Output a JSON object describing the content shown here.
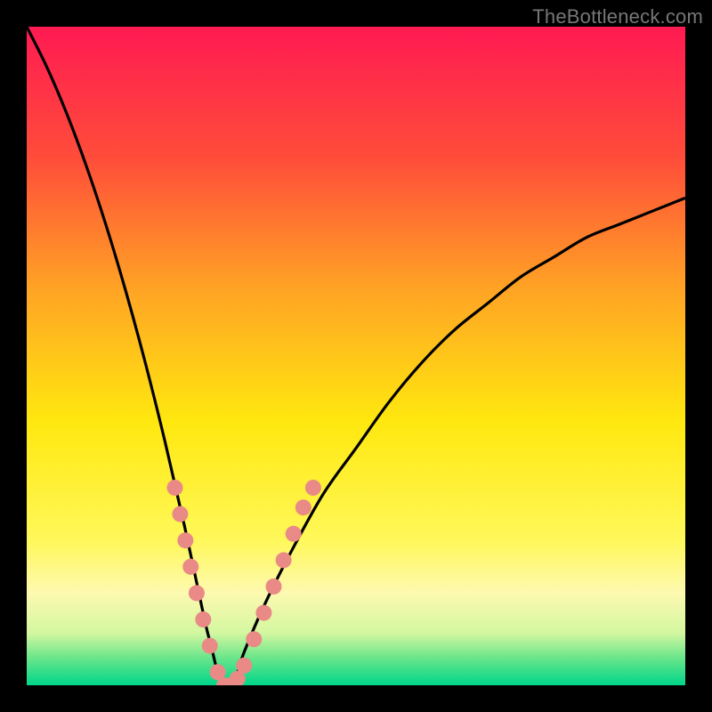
{
  "watermark": "TheBottleneck.com",
  "chart_data": {
    "type": "line",
    "title": "",
    "xlabel": "",
    "ylabel": "",
    "xlim": [
      0,
      100
    ],
    "ylim": [
      0,
      100
    ],
    "grid": false,
    "legend": false,
    "optimal_x": 30,
    "background_gradient": {
      "stops": [
        {
          "offset": 0,
          "color": "#ff1a52"
        },
        {
          "offset": 20,
          "color": "#ff4d3a"
        },
        {
          "offset": 40,
          "color": "#ffa424"
        },
        {
          "offset": 60,
          "color": "#ffe80f"
        },
        {
          "offset": 78,
          "color": "#fff85a"
        },
        {
          "offset": 86,
          "color": "#fdf9b0"
        },
        {
          "offset": 92,
          "color": "#d4f7a0"
        },
        {
          "offset": 96,
          "color": "#66e58a"
        },
        {
          "offset": 100,
          "color": "#00d58a"
        }
      ]
    },
    "series": [
      {
        "name": "bottleneck-curve",
        "description": "V-shaped bottleneck curve; minimum (0) at x≈30, rises steeply left toward 100 and gradually right toward ~70-75",
        "x": [
          0,
          3,
          6,
          9,
          12,
          15,
          18,
          21,
          24,
          27,
          28,
          29,
          30,
          31,
          32,
          33,
          36,
          40,
          45,
          50,
          55,
          60,
          65,
          70,
          75,
          80,
          85,
          90,
          95,
          100
        ],
        "y": [
          100,
          94,
          87,
          79,
          70,
          60,
          49,
          37,
          24,
          10,
          6,
          2,
          0,
          0,
          2,
          5,
          12,
          20,
          29,
          36,
          43,
          49,
          54,
          58,
          62,
          65,
          68,
          70,
          72,
          74
        ]
      }
    ],
    "markers": {
      "name": "curve-markers",
      "color": "#e98a86",
      "radius": 9,
      "points": [
        {
          "x": 22.5,
          "y": 30
        },
        {
          "x": 23.3,
          "y": 26
        },
        {
          "x": 24.1,
          "y": 22
        },
        {
          "x": 24.9,
          "y": 18
        },
        {
          "x": 25.8,
          "y": 14
        },
        {
          "x": 26.8,
          "y": 10
        },
        {
          "x": 27.8,
          "y": 6
        },
        {
          "x": 29.0,
          "y": 2
        },
        {
          "x": 30.0,
          "y": 0
        },
        {
          "x": 31.0,
          "y": 0
        },
        {
          "x": 32.0,
          "y": 1
        },
        {
          "x": 33.0,
          "y": 3
        },
        {
          "x": 34.5,
          "y": 7
        },
        {
          "x": 36.0,
          "y": 11
        },
        {
          "x": 37.5,
          "y": 15
        },
        {
          "x": 39.0,
          "y": 19
        },
        {
          "x": 40.5,
          "y": 23
        },
        {
          "x": 42.0,
          "y": 27
        },
        {
          "x": 43.5,
          "y": 30
        }
      ]
    }
  }
}
